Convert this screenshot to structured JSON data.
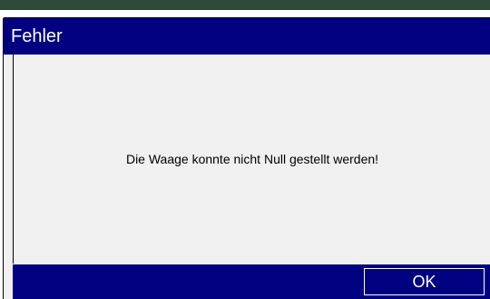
{
  "dialog": {
    "title": "Fehler",
    "message": "Die Waage konnte nicht Null gestellt werden!",
    "ok_label": "OK"
  },
  "colors": {
    "titlebar": "#000080",
    "body": "#f0f0f0",
    "title_text": "#ffffff",
    "message_text": "#000000"
  }
}
